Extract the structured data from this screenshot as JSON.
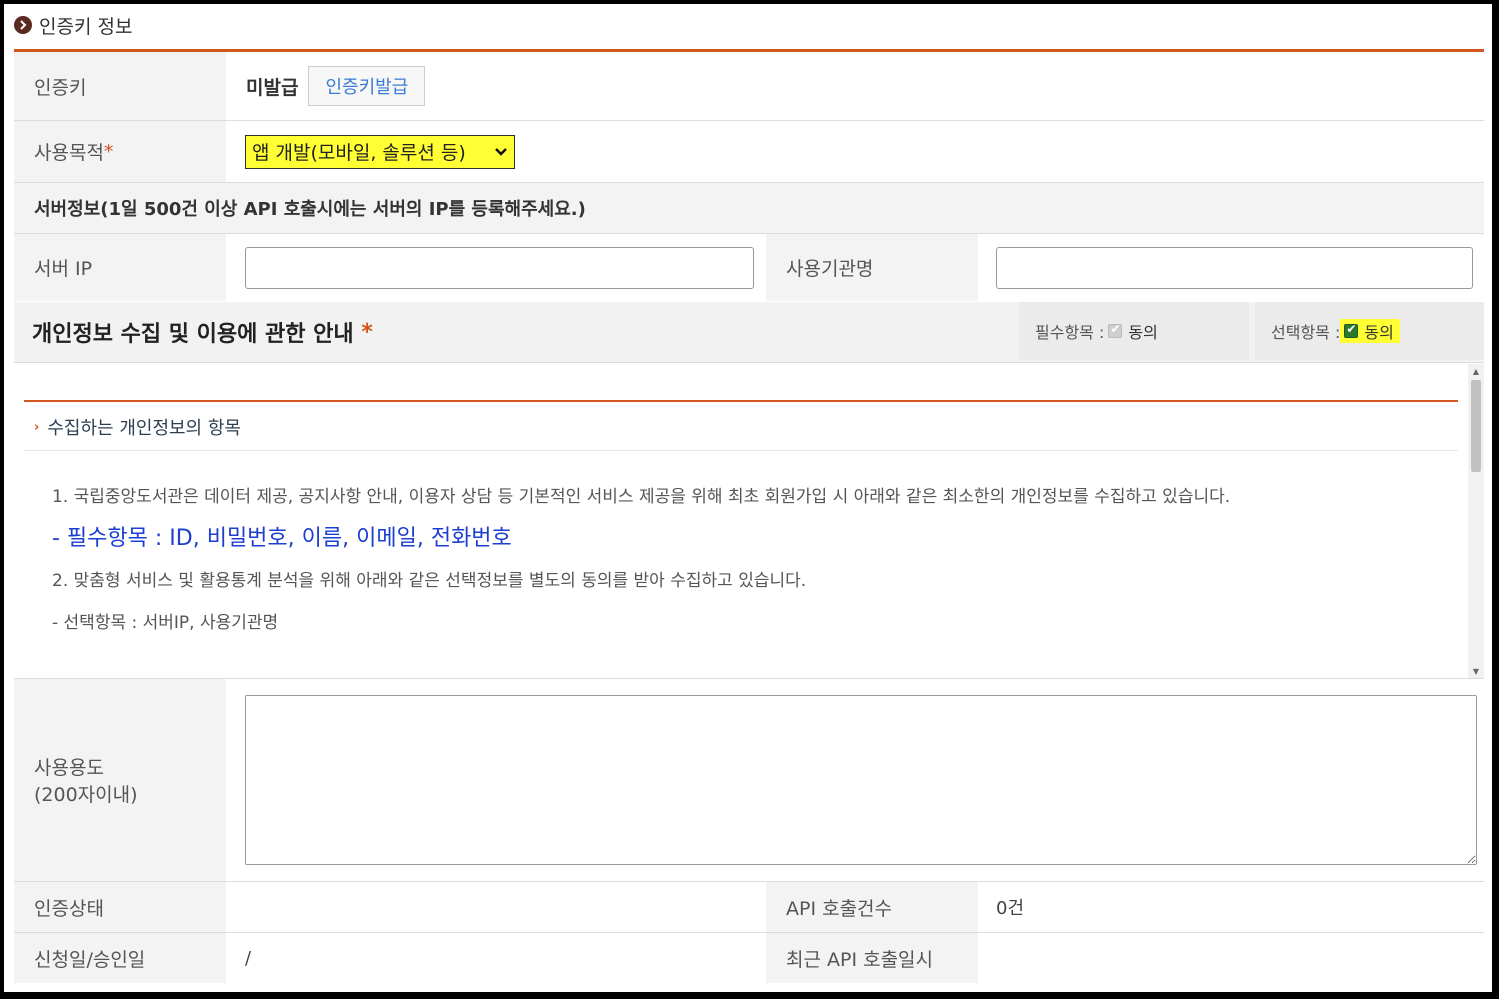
{
  "section": {
    "title": "인증키 정보"
  },
  "auth_key": {
    "label": "인증키",
    "status": "미발급",
    "issue_button": "인증키발급"
  },
  "purpose": {
    "label": "사용목적",
    "required_mark": "*",
    "selected": "앱 개발(모바일, 솔루션 등)"
  },
  "server_info": {
    "heading": "서버정보(1일 500건 이상 API 호출시에는 서버의 IP를 등록해주세요.)"
  },
  "server_ip": {
    "label": "서버 IP",
    "value": ""
  },
  "org_name": {
    "label": "사용기관명",
    "value": ""
  },
  "privacy": {
    "title": "개인정보 수집 및 이용에 관한 안내",
    "required_mark": "*",
    "mandatory_label": "필수항목 :",
    "mandatory_agree": "동의",
    "mandatory_checked": true,
    "optional_label": "선택항목 :",
    "optional_agree": "동의",
    "optional_checked": true,
    "subheading": "수집하는 개인정보의 항목",
    "para1": "1. 국립중앙도서관은 데이터 제공, 공지사항 안내, 이용자 상담 등 기본적인 서비스 제공을 위해 최초 회원가입 시 아래와 같은 최소한의 개인정보를 수집하고 있습니다.",
    "mandatory_items": "- 필수항목 : ID, 비밀번호, 이름, 이메일, 전화번호",
    "para2": "2. 맞춤형 서비스 및 활용통계 분석을 위해 아래와 같은 선택정보를 별도의 동의를 받아 수집하고 있습니다.",
    "optional_items": "- 선택항목 : 서버IP, 사용기관명"
  },
  "usage": {
    "label_line1": "사용용도",
    "label_line2": "(200자이내)",
    "value": ""
  },
  "auth_status": {
    "label": "인증상태",
    "value": ""
  },
  "api_calls": {
    "label": "API 호출건수",
    "value": "0건"
  },
  "request_date": {
    "label": "신청일/승인일",
    "value": "/"
  },
  "last_call": {
    "label": "최근 API 호출일시",
    "value": ""
  },
  "colors": {
    "accent": "#d2541f",
    "highlight": "#ffff33",
    "link_blue": "#3a7bd5",
    "item_blue": "#1c3fd1"
  }
}
